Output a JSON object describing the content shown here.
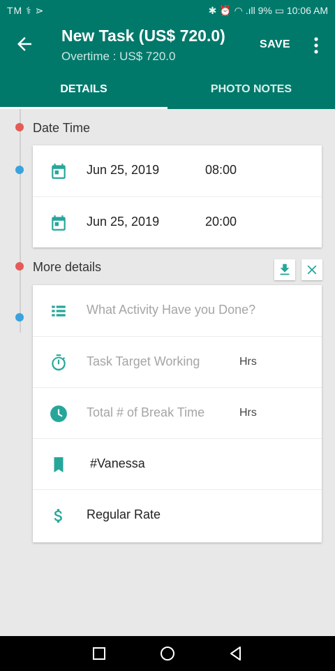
{
  "status_bar": {
    "left": "TM ⚕ ⋗",
    "right": "✱ ⏰ ◠ .ıll 9% ▭ 10:06 AM"
  },
  "header": {
    "title": "New Task (US$  720.0)",
    "subtitle": "Overtime : US$ 720.0",
    "save_label": "SAVE"
  },
  "tabs": [
    {
      "label": "DETAILS",
      "active": true
    },
    {
      "label": "PHOTO NOTES",
      "active": false
    }
  ],
  "date_time_section": {
    "label": "Date Time",
    "rows": [
      {
        "date": "Jun 25, 2019",
        "time": "08:00"
      },
      {
        "date": "Jun 25, 2019",
        "time": "20:00"
      }
    ]
  },
  "more_details_section": {
    "label": "More details",
    "rows": [
      {
        "icon": "list-icon",
        "text": "What Activity Have you Done?",
        "placeholder": true,
        "unit": ""
      },
      {
        "icon": "timer-icon",
        "text": "Task Target Working",
        "placeholder": true,
        "unit": "Hrs"
      },
      {
        "icon": "clock-icon",
        "text": "Total # of Break Time",
        "placeholder": true,
        "unit": "Hrs"
      },
      {
        "icon": "bookmark-icon",
        "text": "#Vanessa",
        "placeholder": false,
        "unit": ""
      },
      {
        "icon": "dollar-icon",
        "text": "Regular Rate",
        "placeholder": false,
        "unit": ""
      }
    ]
  },
  "colors": {
    "primary": "#00796b",
    "accent": "#26a69a",
    "dot_red": "#e55b57",
    "dot_blue": "#3aa3df"
  }
}
